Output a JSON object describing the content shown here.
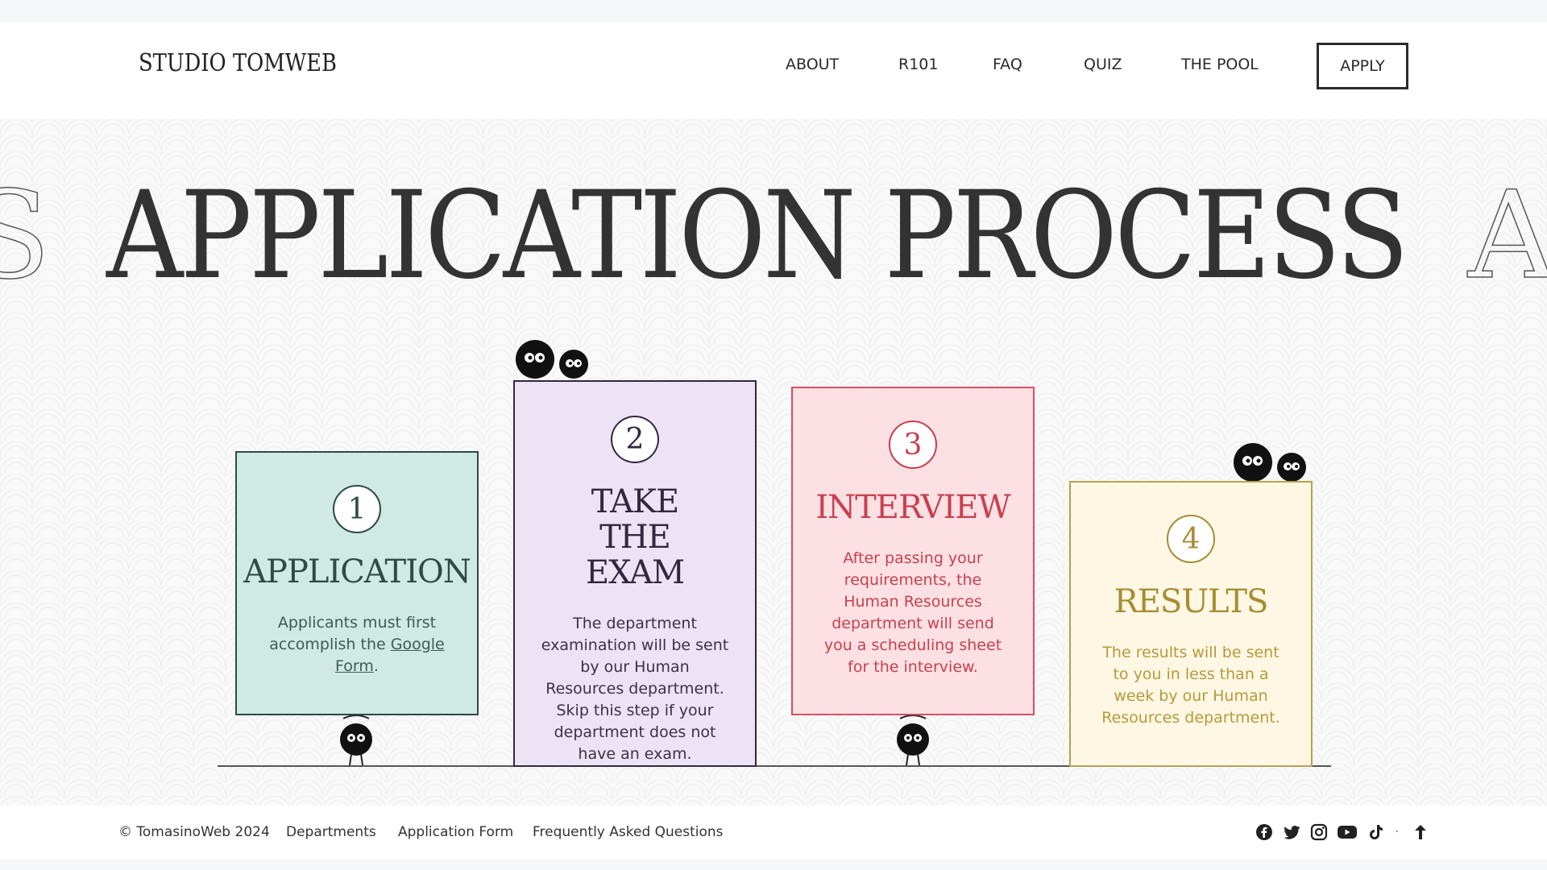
{
  "header": {
    "logo": "STUDIO TOMWEB",
    "nav": [
      "ABOUT",
      "R101",
      "FAQ",
      "QUIZ",
      "THE POOL"
    ],
    "apply_label": "APPLY"
  },
  "hero": {
    "title": "APPLICATION PROCESS",
    "ghost_left": "S",
    "ghost_right": "A"
  },
  "steps": [
    {
      "number": "1",
      "title": "APPLICATION",
      "text": "Applicants must first accomplish the",
      "link": "Google Form",
      "suffix": "."
    },
    {
      "number": "2",
      "title": "TAKE THE EXAM",
      "text": "The department examination will be sent by our Human Resources department. Skip this step if your department does not have an exam."
    },
    {
      "number": "3",
      "title": "INTERVIEW",
      "text": "After passing your requirements, the Human Resources department will send you a scheduling sheet for the interview."
    },
    {
      "number": "4",
      "title": "RESULTS",
      "text": "The results will be sent to you in less than a week by our Human Resources department."
    }
  ],
  "footer": {
    "copyright": "© TomasinoWeb 2024",
    "links": [
      "Departments",
      "Application Form",
      "Frequently Asked Questions"
    ],
    "social_icons": [
      "facebook-icon",
      "twitter-icon",
      "instagram-icon",
      "youtube-icon",
      "tiktok-icon"
    ],
    "separator": "·"
  },
  "colors": {
    "step1_bg": "#cfeae2",
    "step2_bg": "#ece3f5",
    "step3_bg": "#fde0e3",
    "step4_bg": "#fdf7e4",
    "step3_accent": "#c8404f",
    "step4_accent": "#a88c30"
  }
}
